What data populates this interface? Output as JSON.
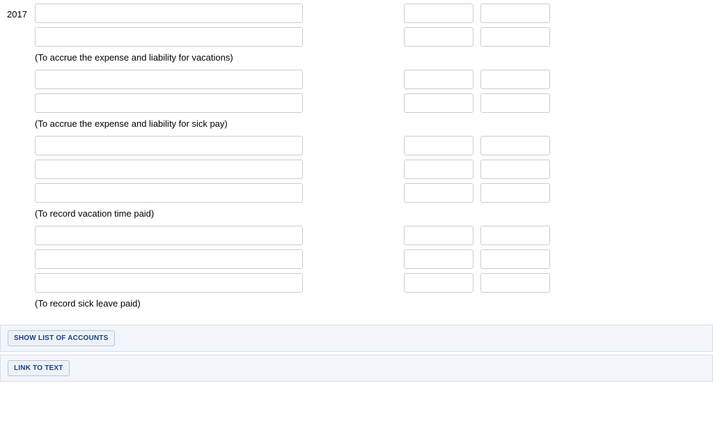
{
  "year": "2017",
  "sections": [
    {
      "rows": 2,
      "description": "(To accrue the expense and liability for vacations)"
    },
    {
      "rows": 2,
      "description": "(To accrue the expense and liability for sick pay)"
    },
    {
      "rows": 3,
      "description": "(To record vacation time paid)"
    },
    {
      "rows": 3,
      "description": "(To record sick leave paid)"
    }
  ],
  "buttons": {
    "showAccounts": "SHOW LIST OF ACCOUNTS",
    "linkToText": "LINK TO TEXT"
  }
}
